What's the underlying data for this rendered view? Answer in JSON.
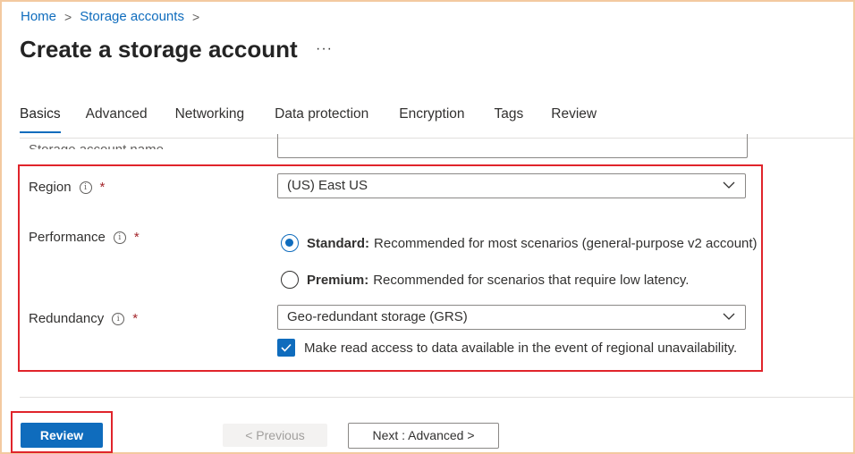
{
  "breadcrumb": {
    "items": [
      "Home",
      "Storage accounts"
    ]
  },
  "page": {
    "title": "Create a storage account",
    "more": "···"
  },
  "tabs": [
    {
      "label": "Basics",
      "active": true
    },
    {
      "label": "Advanced"
    },
    {
      "label": "Networking"
    },
    {
      "label": "Data protection"
    },
    {
      "label": "Encryption"
    },
    {
      "label": "Tags"
    },
    {
      "label": "Review"
    }
  ],
  "form": {
    "storage_name_label": "Storage account name",
    "region": {
      "label": "Region",
      "value": "(US) East US",
      "required": "*"
    },
    "performance": {
      "label": "Performance",
      "required": "*",
      "options": [
        {
          "bold": "Standard:",
          "text": "Recommended for most scenarios (general-purpose v2 account)",
          "selected": true
        },
        {
          "bold": "Premium:",
          "text": "Recommended for scenarios that require low latency.",
          "selected": false
        }
      ]
    },
    "redundancy": {
      "label": "Redundancy",
      "required": "*",
      "value": "Geo-redundant storage (GRS)",
      "checkbox_label": "Make read access to data available in the event of regional unavailability.",
      "checked": true
    }
  },
  "footer": {
    "review": "Review",
    "previous": "< Previous",
    "next": "Next : Advanced >"
  },
  "colors": {
    "accent": "#0f6cbd",
    "highlight": "#e0242b",
    "frame": "#f3c9a0"
  }
}
